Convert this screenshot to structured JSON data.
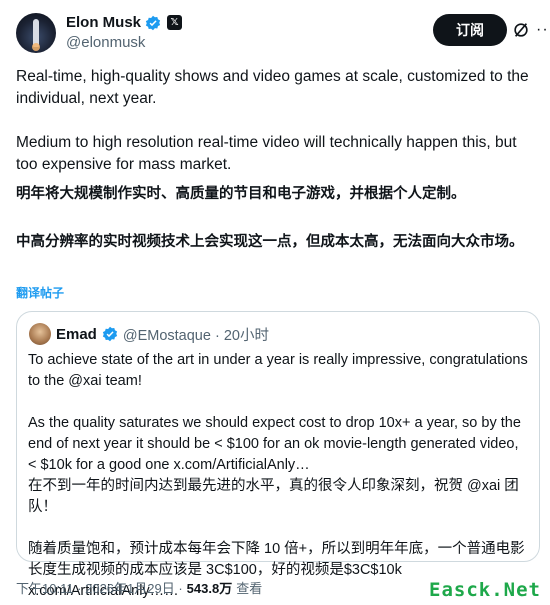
{
  "author": {
    "name": "Elon Musk",
    "handle": "@elonmusk"
  },
  "actions": {
    "subscribe_label": "订阅"
  },
  "tweet": {
    "en_paragraph_1": "Real-time, high-quality shows and video games at scale, customized to the individual, next year.",
    "en_paragraph_2": "Medium to high resolution real-time video will technically happen this, but too expensive for mass market.",
    "zh_paragraph_1": "明年将大规模制作实时、高质量的节目和电子游戏，并根据个人定制。",
    "zh_paragraph_2": "中高分辨率的实时视频技术上会实现这一点，但成本太高，无法面向大众市场。",
    "translate_label": "翻译帖子"
  },
  "quoted": {
    "name": "Emad",
    "handle_time": "@EMostaque · 20小时",
    "en_paragraph_1": "To achieve state of the art in under a year is really impressive, congratulations to the @xai team!",
    "en_paragraph_2": "As the quality saturates we should expect cost to drop 10x+ a year, so by the end of next year it should be < $100 for an ok movie-length generated video, < $10k for a good one x.com/ArtificialAnly…",
    "zh_paragraph_1": "在不到一年的时间内达到最先进的水平，真的很令人印象深刻，祝贺 @xai 团队！",
    "zh_paragraph_2": "随着质量饱和，预计成本每年会下降 10 倍+，所以到明年年底，一个普通电影长度生成视频的成本应该是 3C$100，好的视频是$3C$10k x.com/ArtificialAnly……"
  },
  "meta": {
    "time_date": "下午10:11 · 2026年1月29日 ·",
    "views_count": "543.8万",
    "views_label": "查看"
  },
  "watermark": "Easck.Net",
  "colors": {
    "verified_blue": "#1d9bf0",
    "link_blue": "#1d9bf0",
    "secondary_text": "#536471",
    "primary_text": "#0f1419",
    "watermark_green": "#1ea84a"
  }
}
